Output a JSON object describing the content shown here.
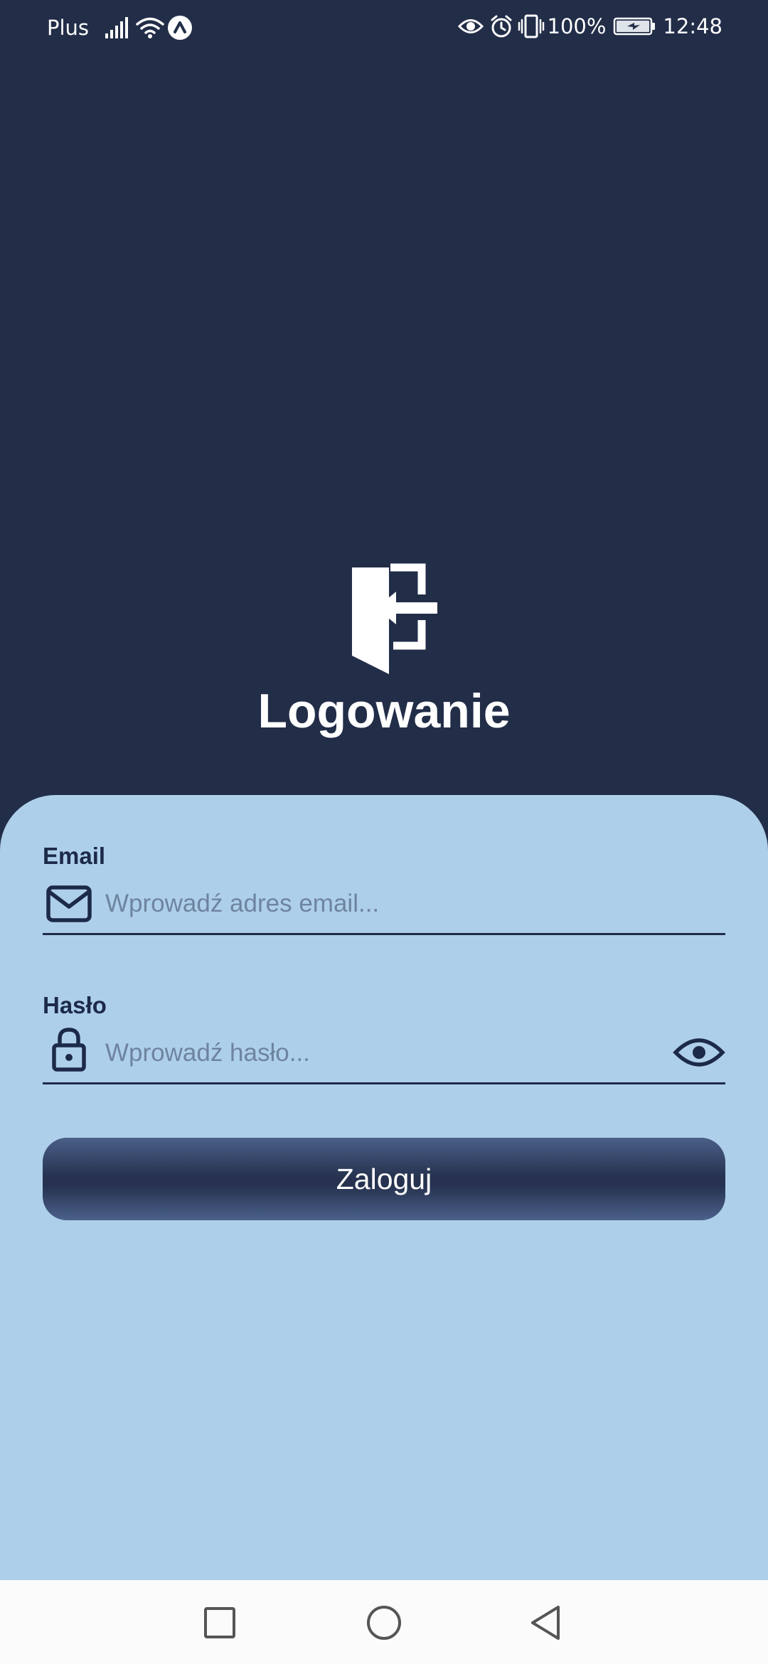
{
  "status_bar": {
    "carrier": "Plus",
    "battery_percent": "100%",
    "time": "12:48",
    "icons": [
      "signal-icon",
      "wifi-icon",
      "data-saver-icon",
      "eye-comfort-icon",
      "alarm-icon",
      "vibrate-icon",
      "battery-icon"
    ]
  },
  "header": {
    "icon": "login-door-icon",
    "title": "Logowanie"
  },
  "form": {
    "email": {
      "label": "Email",
      "placeholder": "Wprowadź adres email...",
      "value": "",
      "icon": "mail-icon"
    },
    "password": {
      "label": "Hasło",
      "placeholder": "Wprowadź hasło...",
      "value": "",
      "icon": "lock-icon",
      "toggle_icon": "eye-icon"
    },
    "submit_label": "Zaloguj"
  },
  "colors": {
    "background": "#222d48",
    "card": "#aecfea",
    "text_dark": "#1c2a48",
    "placeholder": "#6e849e",
    "button": "#26324f"
  },
  "nav_bar": {
    "icons": [
      "recent-apps-icon",
      "home-icon",
      "back-icon"
    ]
  }
}
